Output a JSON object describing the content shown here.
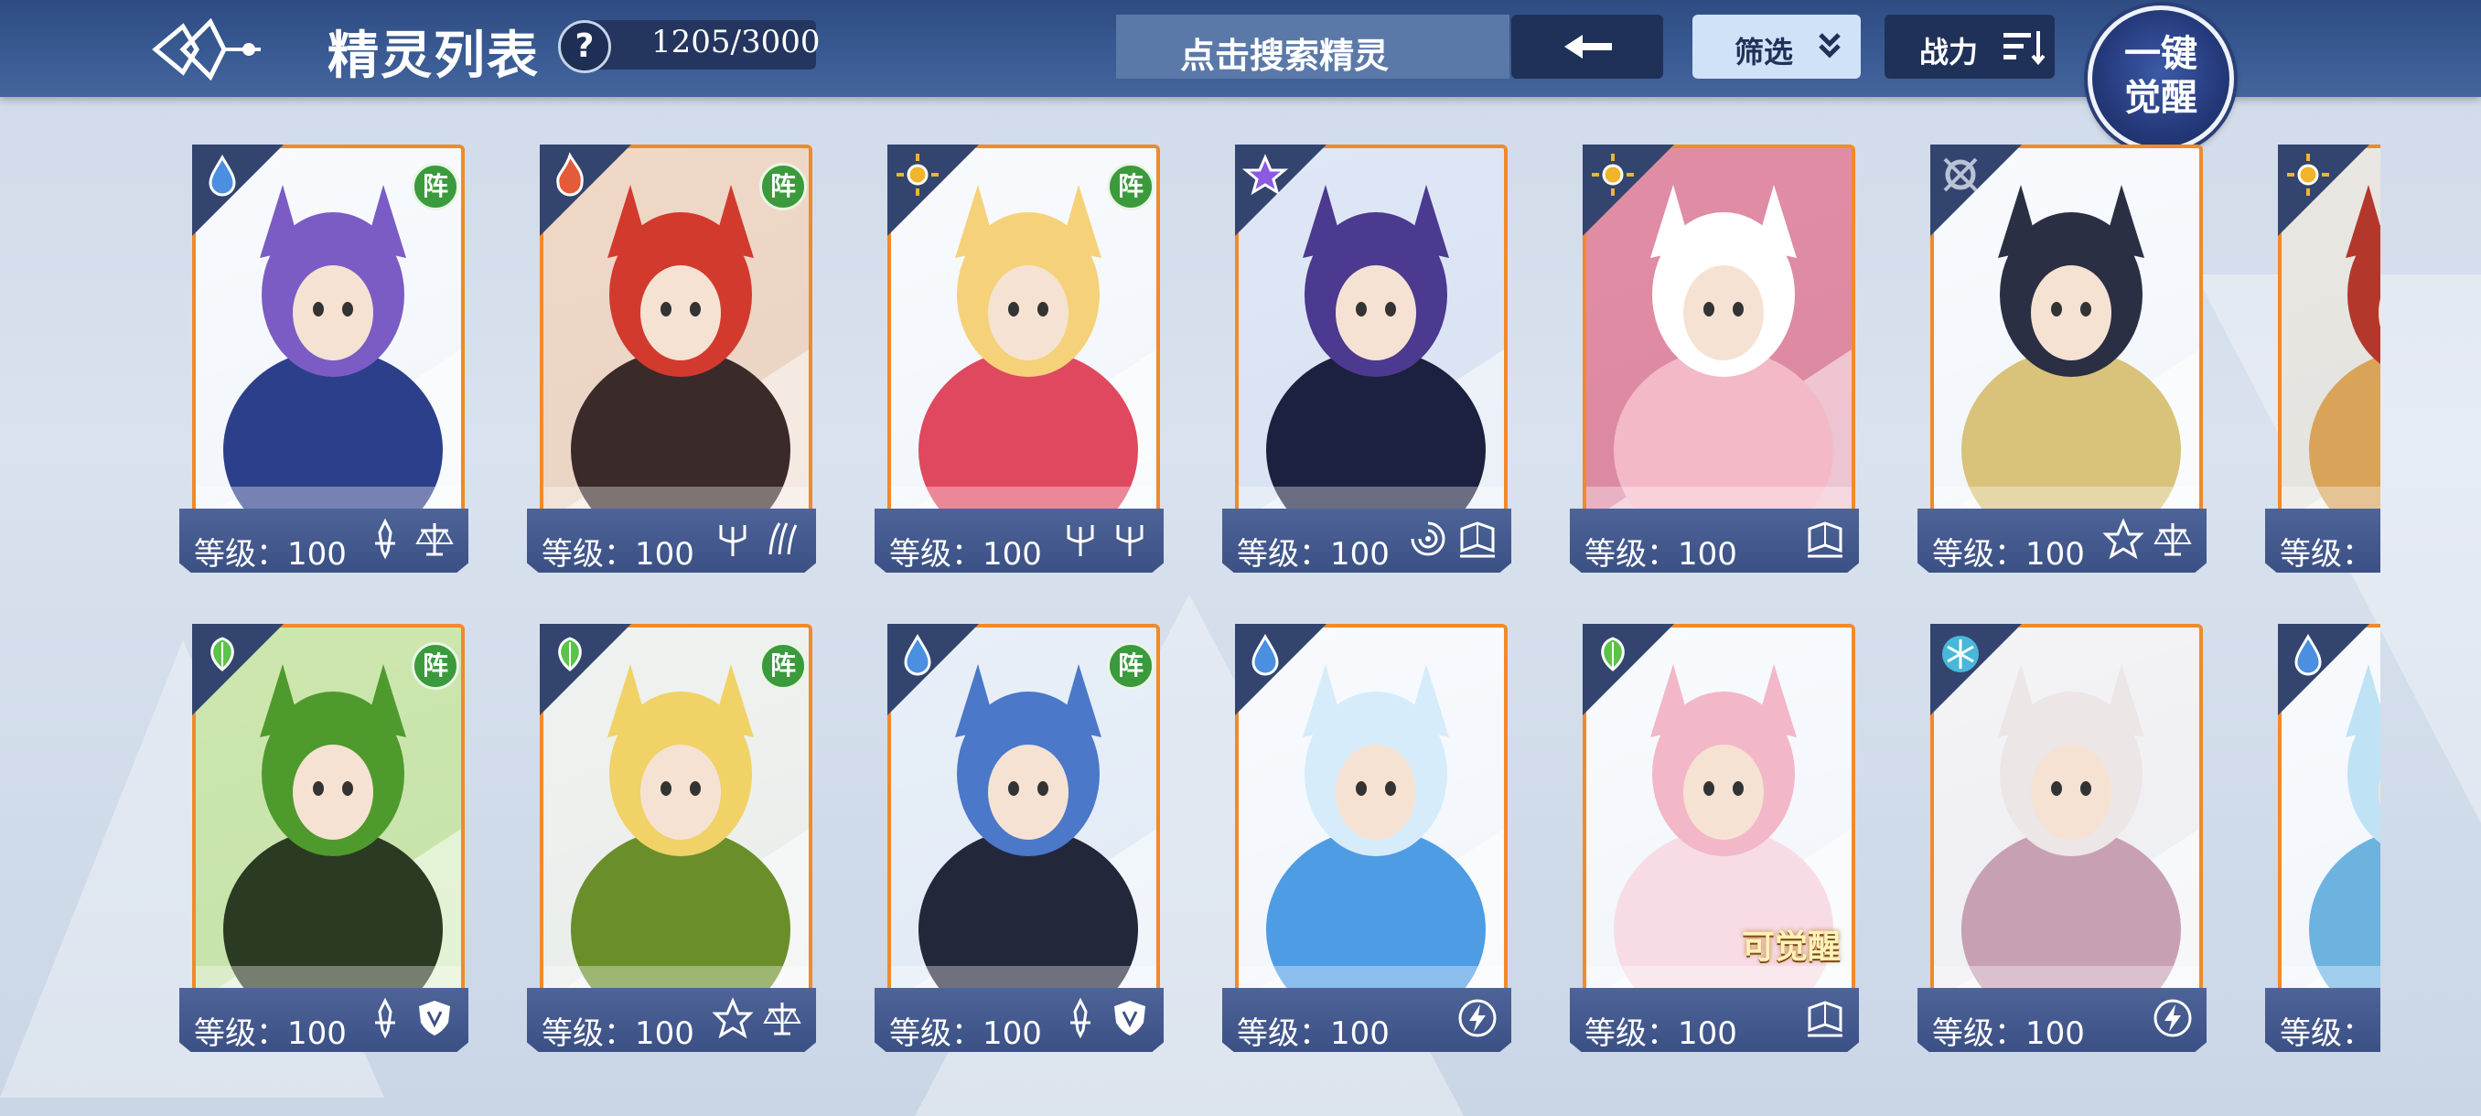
{
  "header": {
    "title": "精灵列表",
    "help": "?",
    "count": "1205/3000",
    "search_label": "点击搜索精灵",
    "filter_label": "筛选",
    "power_label": "战力",
    "awaken_line1": "一键",
    "awaken_line2": "觉醒"
  },
  "colors": {
    "header": "#3a5b94",
    "card_border": "#f08a2a",
    "level_strip": "#4e6498",
    "zhen_badge": "#3b9a3c"
  },
  "cards": [
    {
      "element": "water",
      "zhen": "阵",
      "level": "等级：100",
      "classes": [
        "sword-icon",
        "scale-icon"
      ],
      "art": "purple-hair-lord"
    },
    {
      "element": "fire",
      "zhen": "阵",
      "level": "等级：100",
      "classes": [
        "trident-icon",
        "claw-icon"
      ],
      "art": "red-hair-wolf"
    },
    {
      "element": "light",
      "zhen": "阵",
      "level": "等级：100",
      "classes": [
        "trident-icon",
        "trident-icon"
      ],
      "art": "blonde-idol"
    },
    {
      "element": "dark",
      "zhen": "",
      "level": "等级：100",
      "classes": [
        "vortex-icon",
        "book-icon"
      ],
      "art": "purple-hair-wolf"
    },
    {
      "element": "light",
      "zhen": "",
      "level": "等级：100",
      "classes": [
        "book-icon"
      ],
      "art": "white-fox-pet"
    },
    {
      "element": "mechanic",
      "zhen": "",
      "level": "等级：100",
      "classes": [
        "star-icon",
        "scale-icon"
      ],
      "art": "dark-hair-king"
    },
    {
      "element": "light",
      "zhen": "",
      "level": "等级：",
      "classes": [],
      "art": "armored-partial"
    },
    {
      "element": "grass",
      "zhen": "阵",
      "level": "等级：100",
      "classes": [
        "sword-icon",
        "shield-icon"
      ],
      "art": "green-hair-ranger"
    },
    {
      "element": "grass",
      "zhen": "阵",
      "level": "等级：100",
      "classes": [
        "star-icon",
        "scale-icon"
      ],
      "art": "blonde-goggles"
    },
    {
      "element": "water",
      "zhen": "阵",
      "level": "等级：100",
      "classes": [
        "sword-icon",
        "shield-icon"
      ],
      "art": "blue-hair-ninja"
    },
    {
      "element": "water",
      "zhen": "",
      "level": "等级：100",
      "classes": [
        "lightning-icon"
      ],
      "art": "blue-fox-pet"
    },
    {
      "element": "grass",
      "zhen": "",
      "level": "等级：100",
      "classes": [
        "book-icon"
      ],
      "art": "pink-fairy",
      "tag": "可觉醒"
    },
    {
      "element": "ice",
      "zhen": "",
      "level": "等级：100",
      "classes": [
        "lightning-icon"
      ],
      "art": "white-priestess"
    },
    {
      "element": "water",
      "zhen": "",
      "level": "等级：",
      "classes": [],
      "art": "ice-partial"
    }
  ]
}
